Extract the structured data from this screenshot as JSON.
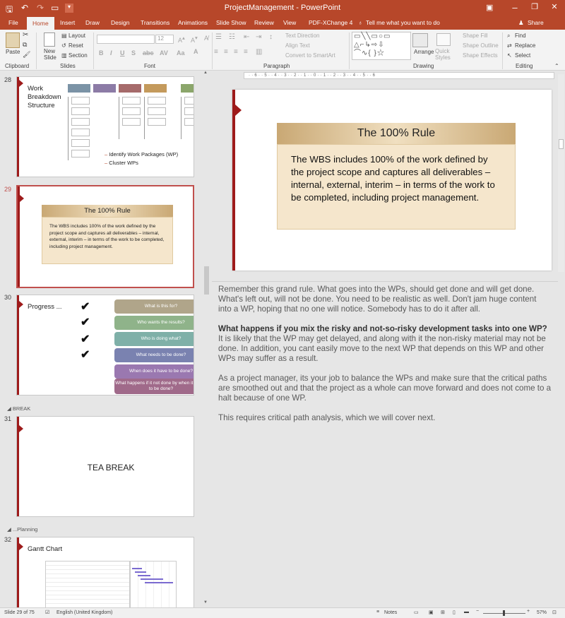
{
  "titlebar": {
    "title": "ProjectManagement - PowerPoint",
    "controls": {
      "minimize": "–",
      "restore": "❐",
      "close": "✕"
    }
  },
  "tabs": [
    "File",
    "Home",
    "Insert",
    "Draw",
    "Design",
    "Transitions",
    "Animations",
    "Slide Show",
    "Review",
    "View",
    "PDF-XChange 4"
  ],
  "active_tab": "Home",
  "tell_me": "Tell me what you want to do",
  "share": "Share",
  "ribbon": {
    "clipboard": {
      "paste": "Paste",
      "label": "Clipboard"
    },
    "slides": {
      "new_slide": "New Slide",
      "layout": "Layout",
      "reset": "Reset",
      "section": "Section",
      "label": "Slides"
    },
    "font": {
      "size": "12",
      "label": "Font",
      "bold": "B",
      "italic": "I",
      "underline": "U",
      "strike": "S",
      "aa": "AV"
    },
    "paragraph": {
      "text_direction": "Text Direction",
      "align_text": "Align Text",
      "smartart": "Convert to SmartArt",
      "label": "Paragraph"
    },
    "drawing": {
      "arrange": "Arrange",
      "quick_styles": "Quick Styles",
      "shape_fill": "Shape Fill",
      "shape_outline": "Shape Outline",
      "shape_effects": "Shape Effects",
      "label": "Drawing"
    },
    "editing": {
      "find": "Find",
      "replace": "Replace",
      "select": "Select",
      "label": "Editing"
    }
  },
  "thumbnails": [
    {
      "num": "28",
      "title": "Work Breakdown Structure",
      "bullets": [
        "Identify Work Packages (WP)",
        "Cluster WPs"
      ]
    },
    {
      "num": "29",
      "title": "The 100% Rule",
      "body": "The WBS includes 100% of the work defined by the project scope and captures all deliverables – internal, external, interim – in terms of the work to be completed, including project management."
    },
    {
      "num": "30",
      "title": "Progress ...",
      "steps": [
        "What is this for?",
        "Who wants the results?",
        "Who is doing what?",
        "What needs to be done?",
        "When does it have to be done?",
        "What happens if it not done by when it needs to be done?"
      ],
      "step_colors": [
        "#b0a58a",
        "#8fb38a",
        "#7fb0a8",
        "#7a82b0",
        "#9a78b0",
        "#a06a8a"
      ]
    },
    {
      "num": "31",
      "title": "TEA BREAK"
    },
    {
      "num": "32",
      "title": "Gantt Chart"
    }
  ],
  "sections": [
    "BREAK",
    "...Planning"
  ],
  "current_slide": {
    "title": "The 100% Rule",
    "body": "The WBS includes 100% of the work defined by the project scope and captures all deliverables – internal, external, interim – in terms of the work to be completed, including project management."
  },
  "notes": {
    "p1": "Remember this grand rule. What goes into the WPs, should get done and will get done. What's left out, will not be done. You need to be realistic as well. Don't jam huge content into a WP, hoping that no one will notice. Somebody has to do it after all.",
    "p2_heading": "What happens if you mix the risky and not-so-risky development tasks into one WP?",
    "p2": "It is likely that the WP may get delayed, and along with it the non-risky material may not be done. In addition, you cant easily move to the next WP that depends on this WP and other WPs may suffer as a result.",
    "p3": "As a project manager, its your job to balance the WPs and make sure that the critical paths are smoothed out and that the project as a whole can move forward and does not come to a halt because of one WP.",
    "p4": "This requires critical path analysis, which we will cover next."
  },
  "statusbar": {
    "slide_count": "Slide 29 of 75",
    "language": "English (United Kingdom)",
    "notes": "Notes",
    "zoom": "57%"
  },
  "colors": {
    "accent": "#b7472a",
    "slide_red": "#9e1b1b",
    "selected_border": "#c0504d"
  }
}
